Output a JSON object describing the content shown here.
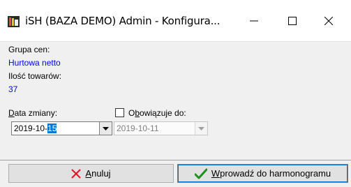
{
  "window": {
    "title": "iSH (BAZA DEMO) Admin - Konfigura...",
    "icon": "app-icon",
    "controls": {
      "minimize_icon": "minimize-icon",
      "maximize_icon": "maximize-icon",
      "close_icon": "close-icon"
    }
  },
  "info": {
    "price_group_label": "Grupa cen:",
    "price_group_value": "Hurtowa netto",
    "product_count_label": "Ilość towarów:",
    "product_count_value": "37"
  },
  "form": {
    "change_date_label_accel": "D",
    "change_date_label_rest": "ata zmiany:",
    "change_date_prefix": "2019-10-",
    "change_date_selected": "15",
    "valid_until_checked": false,
    "valid_until_label_first": "O",
    "valid_until_label_accel": "b",
    "valid_until_label_rest": "owiązuje do:",
    "valid_until_value": "2019-10-11"
  },
  "buttons": {
    "cancel_accel": "A",
    "cancel_rest": "nuluj",
    "submit_accel": "W",
    "submit_rest": "prowadź do harmonogramu"
  },
  "colors": {
    "accent": "#0078d7",
    "value_blue": "#0000ff",
    "cancel_red": "#e81123",
    "check_green": "#1f8f1f"
  }
}
